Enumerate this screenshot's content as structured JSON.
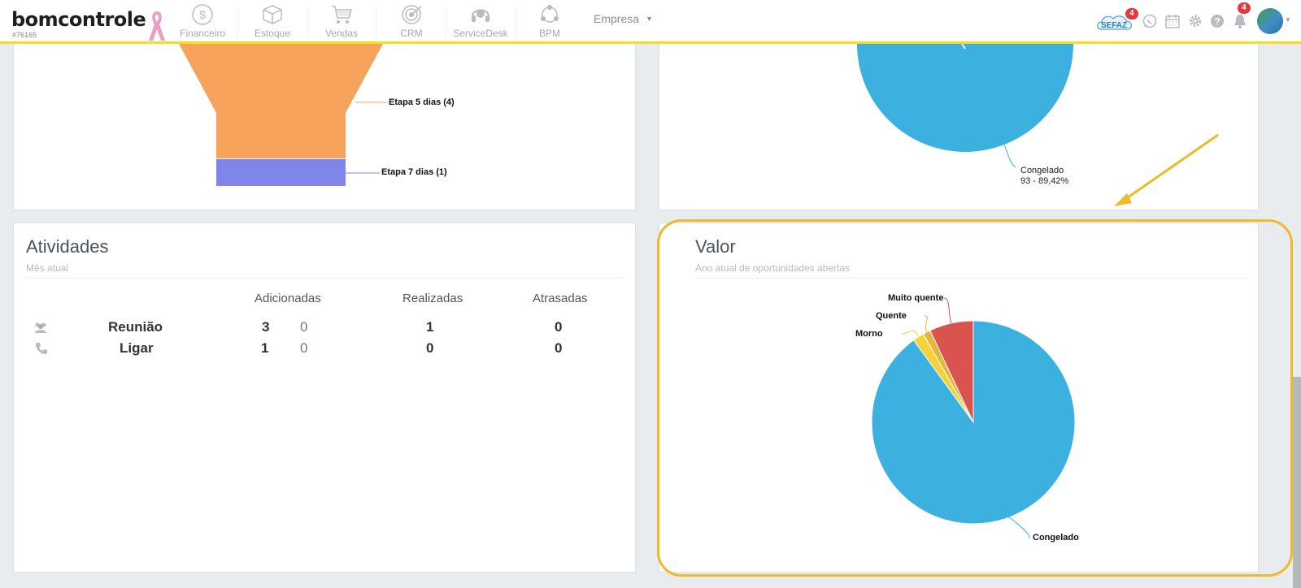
{
  "header": {
    "logo": "bomcontrole",
    "account_id": "#76165",
    "nav": [
      {
        "label": "Financeiro",
        "icon": "dollar-coin-icon"
      },
      {
        "label": "Estoque",
        "icon": "box-icon"
      },
      {
        "label": "Vendas",
        "icon": "shopping-cart-icon"
      },
      {
        "label": "CRM",
        "icon": "target-icon"
      },
      {
        "label": "ServiceDesk",
        "icon": "headset-icon"
      },
      {
        "label": "BPM",
        "icon": "network-icon"
      }
    ],
    "company_select": "Empresa",
    "sefaz_label": "SEFAZ",
    "sefaz_badge": "4",
    "notifications_badge": "4"
  },
  "funnel_panel": {
    "chart_data": {
      "type": "funnel",
      "categories": [
        "Etapa 5 dias (4)",
        "Etapa 7 dias (1)"
      ],
      "values": [
        4,
        1
      ],
      "colors": [
        "#f7a35c",
        "#8085e9"
      ]
    }
  },
  "top_pie_panel": {
    "chart_data": {
      "type": "pie",
      "labels": [
        "Congelado"
      ],
      "label_value": "93 - 89,42%",
      "values": [
        93
      ],
      "percent": [
        89.42
      ],
      "colors": [
        "#3cb1df"
      ]
    }
  },
  "atividades": {
    "title": "Atividades",
    "subtitle": "Mês atual",
    "columns": [
      "Adicionadas",
      "Realizadas",
      "Atrasadas"
    ],
    "rows": [
      {
        "icon": "users-icon",
        "name": "Reunião",
        "adicionadas": "3",
        "adicionadas_extra": "0",
        "realizadas": "1",
        "atrasadas": "0"
      },
      {
        "icon": "phone-icon",
        "name": "Ligar",
        "adicionadas": "1",
        "adicionadas_extra": "0",
        "realizadas": "0",
        "atrasadas": "0"
      }
    ]
  },
  "valor": {
    "title": "Valor",
    "subtitle": "Ano atual de oportunidades abertas",
    "chart_data": {
      "type": "pie",
      "labels": [
        "Muito quente",
        "Quente",
        "Morno",
        "Congelado"
      ],
      "values": [
        7.0,
        1.2,
        1.8,
        90.0
      ],
      "colors": [
        "#d9534f",
        "#e8b53c",
        "#f2d43a",
        "#3cb1df"
      ]
    }
  }
}
